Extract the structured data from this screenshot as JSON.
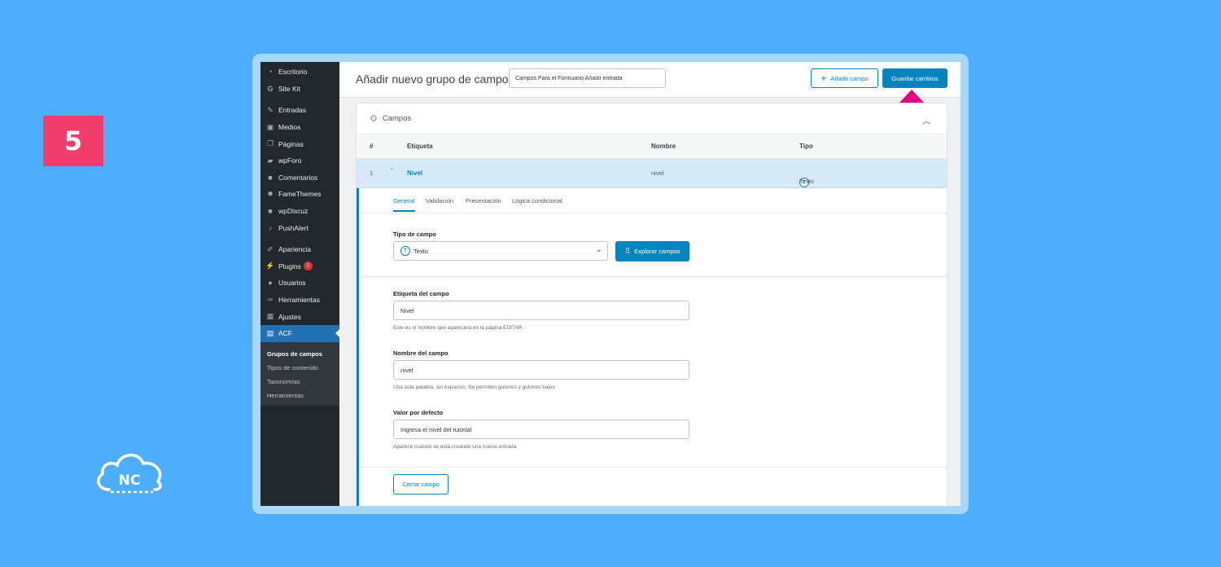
{
  "step_number": "5",
  "brand_logo_text": "NC",
  "sidebar": {
    "items": [
      {
        "label": "Escritorio",
        "icon": "gauge-icon"
      },
      {
        "label": "Site Kit",
        "icon": "google-icon"
      },
      {
        "label": "Entradas",
        "icon": "pin-icon"
      },
      {
        "label": "Medios",
        "icon": "media-icon"
      },
      {
        "label": "Páginas",
        "icon": "pages-icon"
      },
      {
        "label": "wpForo",
        "icon": "forum-icon"
      },
      {
        "label": "Comentarios",
        "icon": "comment-icon"
      },
      {
        "label": "FameThemes",
        "icon": "gear-icon"
      },
      {
        "label": "wpDiscuz",
        "icon": "comment-icon"
      },
      {
        "label": "PushAlert",
        "icon": "bell-icon"
      },
      {
        "label": "Apariencia",
        "icon": "brush-icon"
      },
      {
        "label": "Plugins",
        "icon": "plug-icon",
        "badge": "2"
      },
      {
        "label": "Usuarios",
        "icon": "user-icon"
      },
      {
        "label": "Herramientas",
        "icon": "wrench-icon"
      },
      {
        "label": "Ajustes",
        "icon": "sliders-icon"
      },
      {
        "label": "ACF",
        "icon": "table-icon"
      }
    ],
    "submenu": [
      "Grupos de campos",
      "Tipos de contenido",
      "Taxonomías",
      "Herramientas"
    ]
  },
  "header": {
    "title": "Añadir nuevo grupo de campos",
    "group_title_value": "Campos Para el Formuario Añadir entrada",
    "add_field_label": "Añadir campo",
    "save_label": "Guardar cambios"
  },
  "panel": {
    "title": "Campos",
    "columns": [
      "#",
      "Etiqueta",
      "Nombre",
      "Tipo"
    ],
    "row": {
      "order": "1",
      "label": "Nivel",
      "name": "nivel",
      "type": "Texto"
    }
  },
  "field_settings": {
    "tabs": [
      "General",
      "Validación",
      "Presentación",
      "Lógica condicional"
    ],
    "field_type_label": "Tipo de campo",
    "field_type_value": "Texto",
    "explore_label": "Explorar campos",
    "field_label_label": "Etiqueta del campo",
    "field_label_value": "Nivel",
    "field_label_hint": "Este es el nombre que aparecerá en la página EDITAR",
    "field_name_label": "Nombre del campo",
    "field_name_value": "nivel",
    "field_name_hint": "Una sola palabra, sin espacios. Se permiten guiones y guiones bajos",
    "default_label": "Valor por defecto",
    "default_value": "Ingresa el nivel del tutorial",
    "default_hint": "Aparece cuando se está creando una nueva entrada",
    "close_label": "Cerrar campo"
  },
  "colors": {
    "accent": "#0783be",
    "background": "#4fadfe",
    "step_badge": "#f23c6b",
    "arrow": "#e6007e"
  }
}
